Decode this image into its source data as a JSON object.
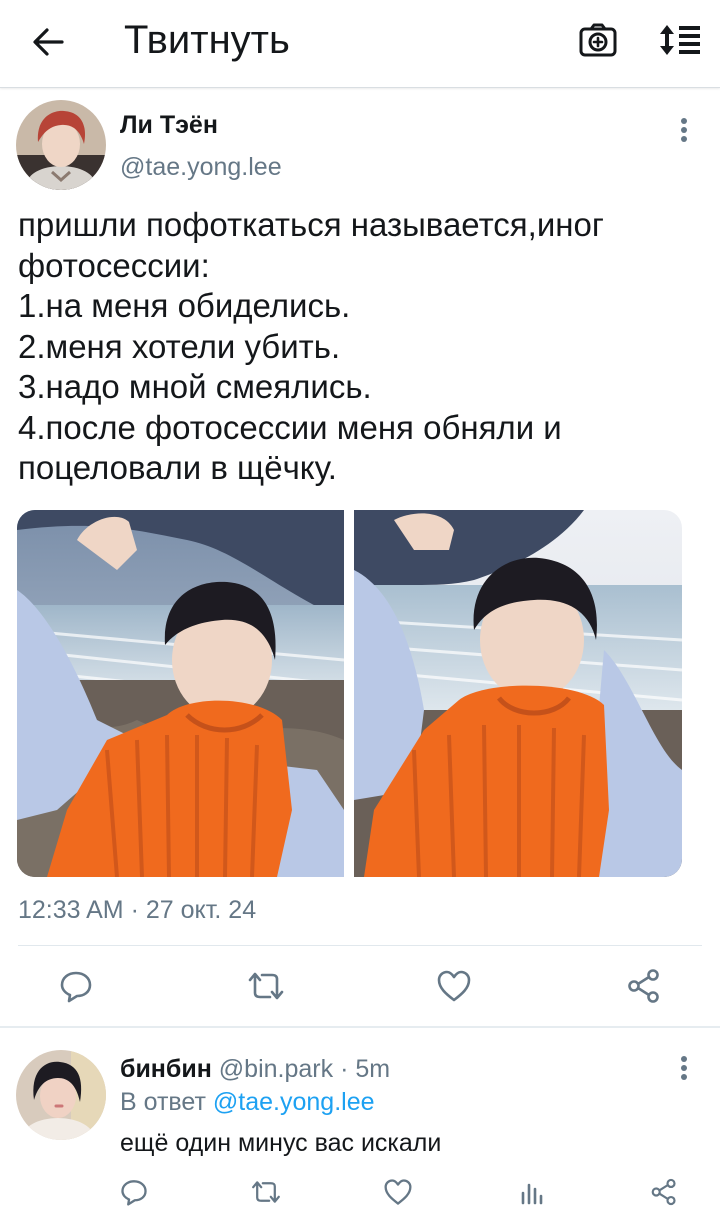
{
  "header": {
    "title": "Твитнуть",
    "back_icon": "arrow-left-icon",
    "camera_icon": "camera-plus-icon",
    "sort_icon": "sort-lines-icon"
  },
  "tweet": {
    "author_name": "Ли Тэён",
    "author_handle": "@tae.yong.lee",
    "text_lines": [
      "пришли пофоткаться называется,иног",
      "фотосессии:",
      "1.на меня обиделись.",
      "2.меня хотели убить.",
      "3.надо мной смеялись.",
      "4.после фотосессии меня обняли и",
      "поцеловали в щёчку."
    ],
    "timestamp": "12:33 AM · 27 окт. 24",
    "actions": [
      "reply-icon",
      "retweet-icon",
      "like-icon",
      "share-icon"
    ]
  },
  "reply": {
    "name": "бинбин",
    "handle": "@bin.park",
    "separator": "·",
    "time": "5m",
    "reply_prefix": "В ответ",
    "reply_to": "@tae.yong.lee",
    "text": "ещё один минус вас искали",
    "actions": [
      "reply-icon",
      "retweet-icon",
      "like-icon",
      "analytics-icon",
      "share-icon"
    ]
  },
  "colors": {
    "text": "#14171a",
    "secondary": "#657786",
    "link": "#1da1f2",
    "icon": "#657786",
    "sweater": "#f06a1e"
  }
}
